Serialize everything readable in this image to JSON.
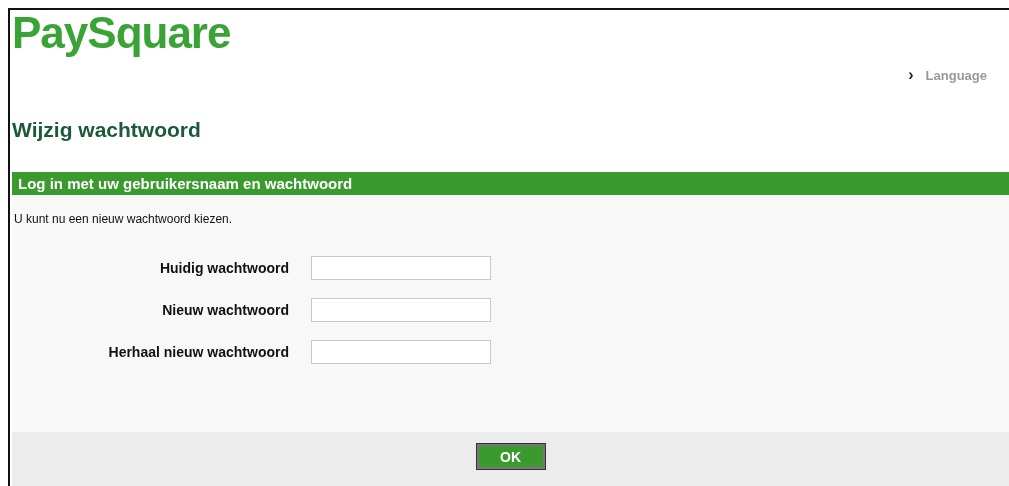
{
  "logo": "PaySquare",
  "language_link": {
    "arrow": "›",
    "label": "Language"
  },
  "title": "Wijzig wachtwoord",
  "panel": {
    "header": "Log in met uw gebruikersnaam en wachtwoord",
    "intro": "U kunt nu een nieuw wachtwoord kiezen.",
    "fields": [
      {
        "label": "Huidig wachtwoord"
      },
      {
        "label": "Nieuw wachtwoord"
      },
      {
        "label": "Herhaal nieuw wachtwoord"
      }
    ],
    "button": "OK"
  }
}
